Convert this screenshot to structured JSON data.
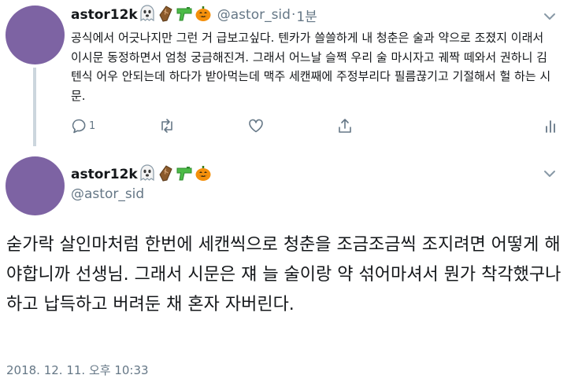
{
  "reply_tweet": {
    "display_name": "astor12k",
    "handle": "@astor_sid",
    "time_sep": "·",
    "time": "1분",
    "text": "공식에서 어긋나지만 그런 거 급보고싶다. 텐카가 쓸쓸하게 내 청춘은 술과 약으로 조졌지 이래서 이시문 동정하면서 엄청 궁금해진겨. 그래서 어느날 슬쩍 우리 술 마시자고 궤짝 떼와서 권하니 김텐식 어우 안되는데 하다가 받아먹는데 맥주 세캔째에 주정부리다 필름끊기고 기절해서 헐 하는 시문.",
    "reply_count": "1"
  },
  "main_tweet": {
    "display_name": "astor12k",
    "handle": "@astor_sid",
    "text": "숟가락 살인마처럼 한번에 세캔씩으로 청춘을 조금조금씩 조지려면 어떻게 해야합니까 선생님. 그래서 시문은 쟤 늘 술이랑 약 섞어마셔서 뭔가 착각했구나 하고 납득하고 버려둔 채 혼자 자버린다.",
    "timestamp": "2018. 12. 11. 오후 10:33"
  },
  "emoji_icons": [
    "ghost-icon",
    "coffin-icon",
    "water-pistol-icon",
    "jack-o-lantern-icon"
  ],
  "colors": {
    "avatar": "#7d63a3",
    "text": "#14171a",
    "secondary": "#657786",
    "thread_line": "#ccd6dd"
  }
}
